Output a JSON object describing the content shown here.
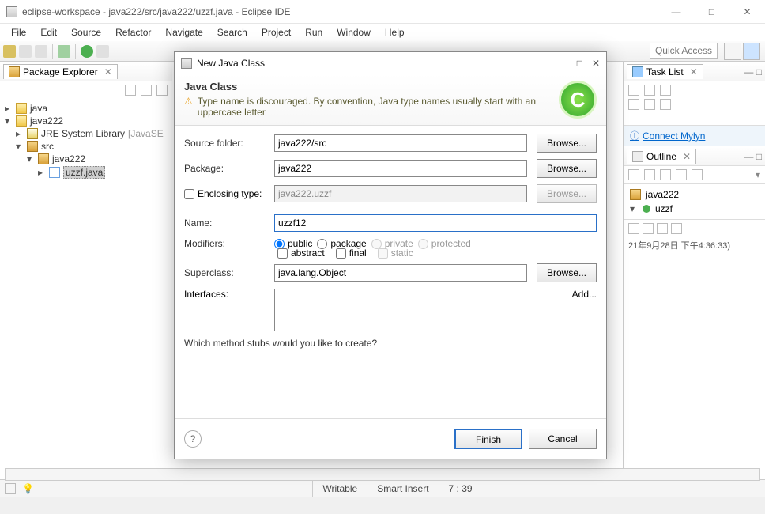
{
  "window": {
    "title": "eclipse-workspace - java222/src/java222/uzzf.java - Eclipse IDE"
  },
  "menu": [
    "File",
    "Edit",
    "Source",
    "Refactor",
    "Navigate",
    "Search",
    "Project",
    "Run",
    "Window",
    "Help"
  ],
  "quick_access": "Quick Access",
  "left": {
    "view_title": "Package Explorer",
    "nodes": {
      "proj_java": "java",
      "proj_java222": "java222",
      "jre": "JRE System Library",
      "jre_suffix": "[JavaSE",
      "src": "src",
      "pkg": "java222",
      "file": "uzzf.java"
    }
  },
  "right": {
    "tasklist": "Task List",
    "connect": "Connect Mylyn",
    "outline": "Outline",
    "outline_pkg": "java222",
    "outline_class": "uzzf",
    "timestamp": "21年9月28日 下午4:36:33)"
  },
  "status": {
    "writable": "Writable",
    "insert": "Smart Insert",
    "pos": "7 : 39"
  },
  "dialog": {
    "title": "New Java Class",
    "heading": "Java Class",
    "warning": "Type name is discouraged. By convention, Java type names usually start with an uppercase letter",
    "labels": {
      "source_folder": "Source folder:",
      "package": "Package:",
      "enclosing": "Enclosing type:",
      "name": "Name:",
      "modifiers": "Modifiers:",
      "superclass": "Superclass:",
      "interfaces": "Interfaces:",
      "stubs": "Which method stubs would you like to create?"
    },
    "values": {
      "source_folder": "java222/src",
      "package": "java222",
      "enclosing": "java222.uzzf",
      "name": "uzzf12",
      "superclass": "java.lang.Object"
    },
    "mods": {
      "public": "public",
      "package": "package",
      "private": "private",
      "protected": "protected",
      "abstract": "abstract",
      "final": "final",
      "static": "static"
    },
    "buttons": {
      "browse": "Browse...",
      "add": "Add...",
      "finish": "Finish",
      "cancel": "Cancel"
    }
  }
}
